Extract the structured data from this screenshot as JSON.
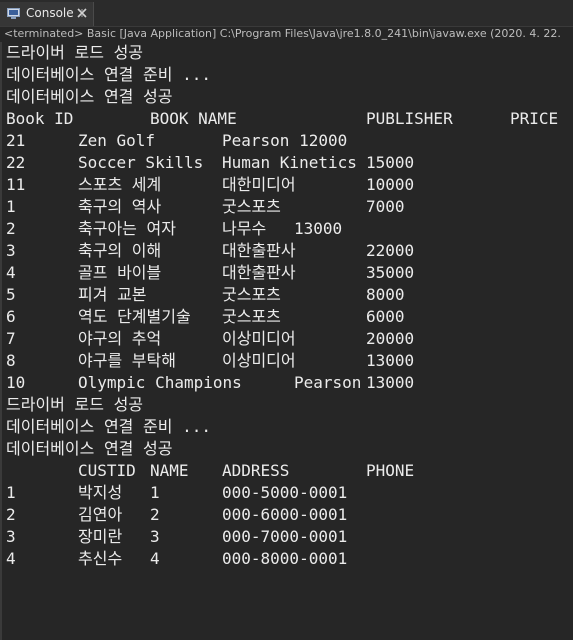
{
  "tab": {
    "label": "Console",
    "icon": "console-icon",
    "close_icon": "close-icon"
  },
  "status_line": "<terminated> Basic [Java Application] C:\\Program Files\\Java\\jre1.8.0_241\\bin\\javaw.exe (2020. 4. 22.",
  "colors": {
    "background": "#262626",
    "text": "#ebebeb"
  },
  "output": {
    "section1": {
      "msg_driver": "드라이버 로드 성공",
      "msg_prepare": "데이터베이스 연결 준비 ...",
      "msg_connected": "데이터베이스 연결 성공"
    },
    "book_table": {
      "headers": [
        "Book ID",
        "BOOK NAME",
        "PUBLISHER",
        "PRICE"
      ],
      "rows": [
        [
          "21",
          "Zen Golf",
          "Pearson 12000",
          ""
        ],
        [
          "22",
          "Soccer Skills",
          "Human Kinetics",
          "15000"
        ],
        [
          "11",
          "스포츠 세계",
          "대한미디어",
          "10000"
        ],
        [
          "1",
          "축구의 역사",
          "굿스포츠",
          "7000"
        ],
        [
          "2",
          "축구아는 여자",
          "나무수",
          "13000"
        ],
        [
          "3",
          "축구의 이해",
          "대한출판사",
          "22000"
        ],
        [
          "4",
          "골프 바이블",
          "대한출판사",
          "35000"
        ],
        [
          "5",
          "피겨 교본",
          "굿스포츠",
          "8000"
        ],
        [
          "6",
          "역도 단계별기술",
          "굿스포츠",
          "6000"
        ],
        [
          "7",
          "야구의 추억",
          "이상미디어",
          "20000"
        ],
        [
          "8",
          "야구를 부탁해",
          "이상미디어",
          "13000"
        ],
        [
          "10",
          "Olympic Champions",
          "Pearson",
          "13000"
        ]
      ]
    },
    "section2": {
      "msg_driver": "드라이버 로드 성공",
      "msg_prepare": "데이터베이스 연결 준비 ...",
      "msg_connected": "데이터베이스 연결 성공"
    },
    "cust_table": {
      "headers": [
        "CUSTID",
        "NAME",
        "ADDRESS",
        "PHONE"
      ],
      "rows": [
        [
          "1",
          "박지성",
          "1",
          "000-5000-0001"
        ],
        [
          "2",
          "김연아",
          "2",
          "000-6000-0001"
        ],
        [
          "3",
          "장미란",
          "3",
          "000-7000-0001"
        ],
        [
          "4",
          "추신수",
          "4",
          "000-8000-0001"
        ]
      ]
    }
  }
}
